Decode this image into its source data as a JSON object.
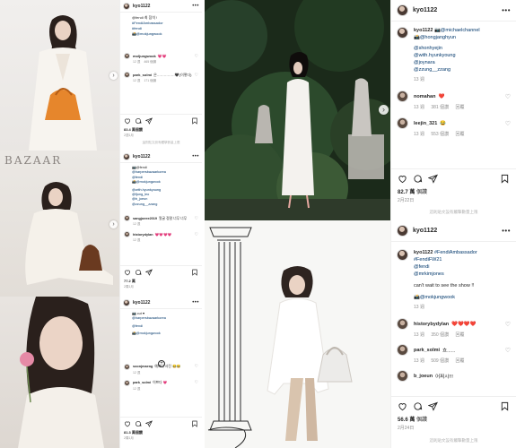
{
  "post1": {
    "username": "kyo1122",
    "caption_lines": [
      "@fendi 최 참석 !",
      "#FendiAmbassador",
      "#fendi",
      "📸@mokjungwook"
    ],
    "comments": [
      {
        "user": "moljungwook",
        "text": "💗💗",
        "time": "12 週",
        "replies": "465 個讚"
      },
      {
        "user": "park_solmi",
        "text": "은……………🖤(이렇다)",
        "time": "12 週",
        "replies": "171 個讚"
      }
    ],
    "likes": "83.4 萬個讚",
    "date": "2週1月"
  },
  "post2": {
    "magazine": "BAZAAR",
    "username": "kyo1122",
    "caption_lines": [
      "📷@fendi",
      "@harpersbazaarkorea",
      "@fendi",
      "📸@mokjungwook",
      "",
      "@with.hyunkyoung",
      "@fjong_leo",
      "@b_joeun",
      "@zzung__zzang"
    ],
    "comments": [
      {
        "user": "sangjoeee2019",
        "text": "얼굴 정말 너무 너무 예쁘다 😍",
        "time": "12 週"
      },
      {
        "user": "historydylan",
        "text": "💗💗💗💗",
        "time": "12 週"
      }
    ],
    "likes": "77.2 萬",
    "date": "2周1月"
  },
  "post3": {
    "username": "kyo1122",
    "caption_lines": [
      "📷 cut ♥",
      "@harpersbazaarkorea",
      "",
      "@fendi",
      "",
      "📸@mokjungwook"
    ],
    "comments": [
      {
        "user": "soonjmaeng",
        "text": "예쁘다 사진 😂😂",
        "time": "12 週"
      },
      {
        "user": "park_solmi",
        "text": "이쁘다 💗",
        "time": "12 週"
      }
    ],
    "likes": "81.3 萬個讚",
    "date": "2周1月"
  },
  "post4": {
    "username": "kyo1122",
    "tags": [
      "📷@michaelchannel",
      "📸@hongjanghyun",
      "",
      "@shonhyejin",
      "@with.hyunkyoung",
      "@joynara",
      "@zzung__zzang"
    ],
    "caption_time": "13 週",
    "comments": [
      {
        "user": "nomahan",
        "text": "❤️",
        "time": "13 週",
        "likes": "381 個讚"
      },
      {
        "user": "leejin_321",
        "text": "😂",
        "time": "13 週",
        "likes": "553 個讚"
      }
    ],
    "likes": "82.7 萬",
    "likes_suffix": "個讚",
    "date": "2月22日"
  },
  "post5": {
    "username": "kyo1122",
    "caption_lines": [
      "#FendiAmbassador",
      "#FendiFW21",
      "@fendi",
      "@mrkimjones",
      "",
      "can't wait to see the show !!",
      "",
      "📸@mokjungwook"
    ],
    "caption_time": "13 週",
    "comments": [
      {
        "user": "historybydylan",
        "text": "❤️❤️❤️❤️",
        "time": "13 週",
        "likes": "350 個讚"
      },
      {
        "user": "park_solmi",
        "text": "흐......",
        "time": "13 週",
        "likes": "509 個讚"
      },
      {
        "user": "b_joeun",
        "text": "어쩌시!!!",
        "time": "",
        "likes": ""
      }
    ],
    "likes": "56.6 萬",
    "likes_suffix": "個讚",
    "date": "2月24日"
  },
  "translate_note": "這則貼文設有觸擊數量上限",
  "colors": {
    "accent": "#0095f6",
    "link": "#00376b",
    "heart": "#ed4956",
    "muted": "#8e8e8e",
    "border": "#efefef"
  },
  "icons": [
    "heart-icon",
    "comment-icon",
    "share-icon",
    "bookmark-icon",
    "more-icon",
    "chevron-right-icon",
    "plus-circle-icon"
  ]
}
